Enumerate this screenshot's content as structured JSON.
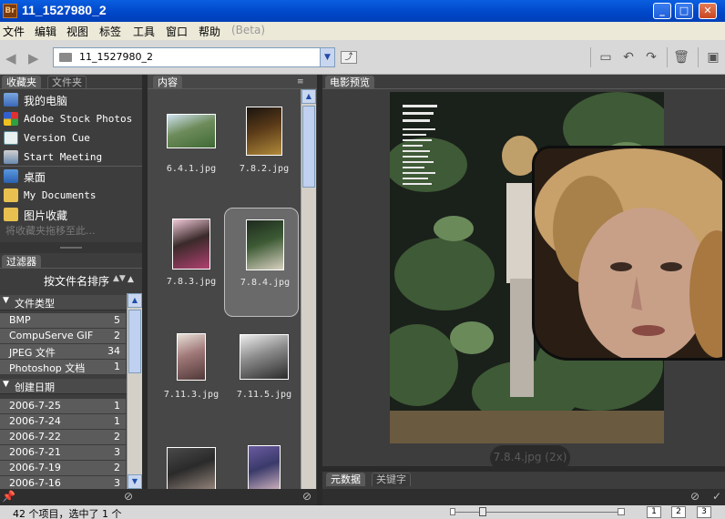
{
  "window": {
    "title": "11_1527980_2",
    "logo": "Br"
  },
  "menu": [
    "文件",
    "编辑",
    "视图",
    "标签",
    "工具",
    "窗口",
    "帮助",
    "(Beta)"
  ],
  "toolbar": {
    "path": "11_1527980_2"
  },
  "panels": {
    "favorites_tabs": [
      "收藏夹",
      "文件夹"
    ],
    "favorites": [
      {
        "label": "我的电脑",
        "icon": "computer-icon"
      },
      {
        "label": "Adobe Stock Photos",
        "icon": "adobe-stock-icon"
      },
      {
        "label": "Version Cue",
        "icon": "version-cue-icon"
      },
      {
        "label": "Start Meeting",
        "icon": "meeting-icon"
      },
      {
        "label": "桌面",
        "icon": "desktop-icon"
      },
      {
        "label": "My Documents",
        "icon": "folder-icon"
      },
      {
        "label": "图片收藏",
        "icon": "pictures-icon"
      }
    ],
    "favorites_hint": "将收藏夹拖移至此...",
    "filter_tab": "过滤器",
    "sort_label": "按文件名排序",
    "file_type": {
      "header": "文件类型",
      "rows": [
        {
          "label": "BMP",
          "count": "5"
        },
        {
          "label": "CompuServe GIF",
          "count": "2"
        },
        {
          "label": "JPEG 文件",
          "count": "34"
        },
        {
          "label": "Photoshop 文档",
          "count": "1"
        }
      ]
    },
    "created_date": {
      "header": "创建日期",
      "rows": [
        {
          "label": "2006-7-25",
          "count": "1"
        },
        {
          "label": "2006-7-24",
          "count": "1"
        },
        {
          "label": "2006-7-22",
          "count": "2"
        },
        {
          "label": "2006-7-21",
          "count": "3"
        },
        {
          "label": "2006-7-19",
          "count": "2"
        },
        {
          "label": "2006-7-16",
          "count": "3"
        }
      ]
    },
    "content_tab": "内容",
    "thumbnails": [
      {
        "label": "6.4.1.jpg",
        "selected": false,
        "palette": [
          "#cfe2f0",
          "#3f6a35",
          "#6e8c5b"
        ]
      },
      {
        "label": "7.8.2.jpg",
        "selected": false,
        "palette": [
          "#1a1410",
          "#b08a3a",
          "#5a3a18"
        ]
      },
      {
        "label": "7.8.3.jpg",
        "selected": false,
        "palette": [
          "#f0c8d8",
          "#b04070",
          "#3a2a2a"
        ]
      },
      {
        "label": "7.8.4.jpg",
        "selected": true,
        "palette": [
          "#1e2a1e",
          "#d8d0c0",
          "#3c5a34"
        ]
      },
      {
        "label": "7.11.3.jpg",
        "selected": false,
        "palette": [
          "#e8e0d8",
          "#503838",
          "#a07878"
        ]
      },
      {
        "label": "7.11.5.jpg",
        "selected": false,
        "palette": [
          "#ededed",
          "#2a2a2a",
          "#8a8a8a"
        ]
      },
      {
        "label": "",
        "selected": false,
        "palette": [
          "#4a4a4a",
          "#9a8a80",
          "#2a2a2a"
        ]
      },
      {
        "label": "",
        "selected": false,
        "palette": [
          "#6a5aa0",
          "#e0c0c8",
          "#3a3a6a"
        ]
      }
    ],
    "preview_tab": "电影预览",
    "preview_caption": "7.8.4.jpg (2x)",
    "metadata_tabs": [
      "元数据",
      "关键字"
    ]
  },
  "status": {
    "text": "42 个项目，选中了 1 个",
    "views": [
      "1",
      "2",
      "3"
    ]
  },
  "colors": {
    "titlebar": "#0a5fe0",
    "panel": "#3d3d3d",
    "selection": "#6a6a6a"
  }
}
